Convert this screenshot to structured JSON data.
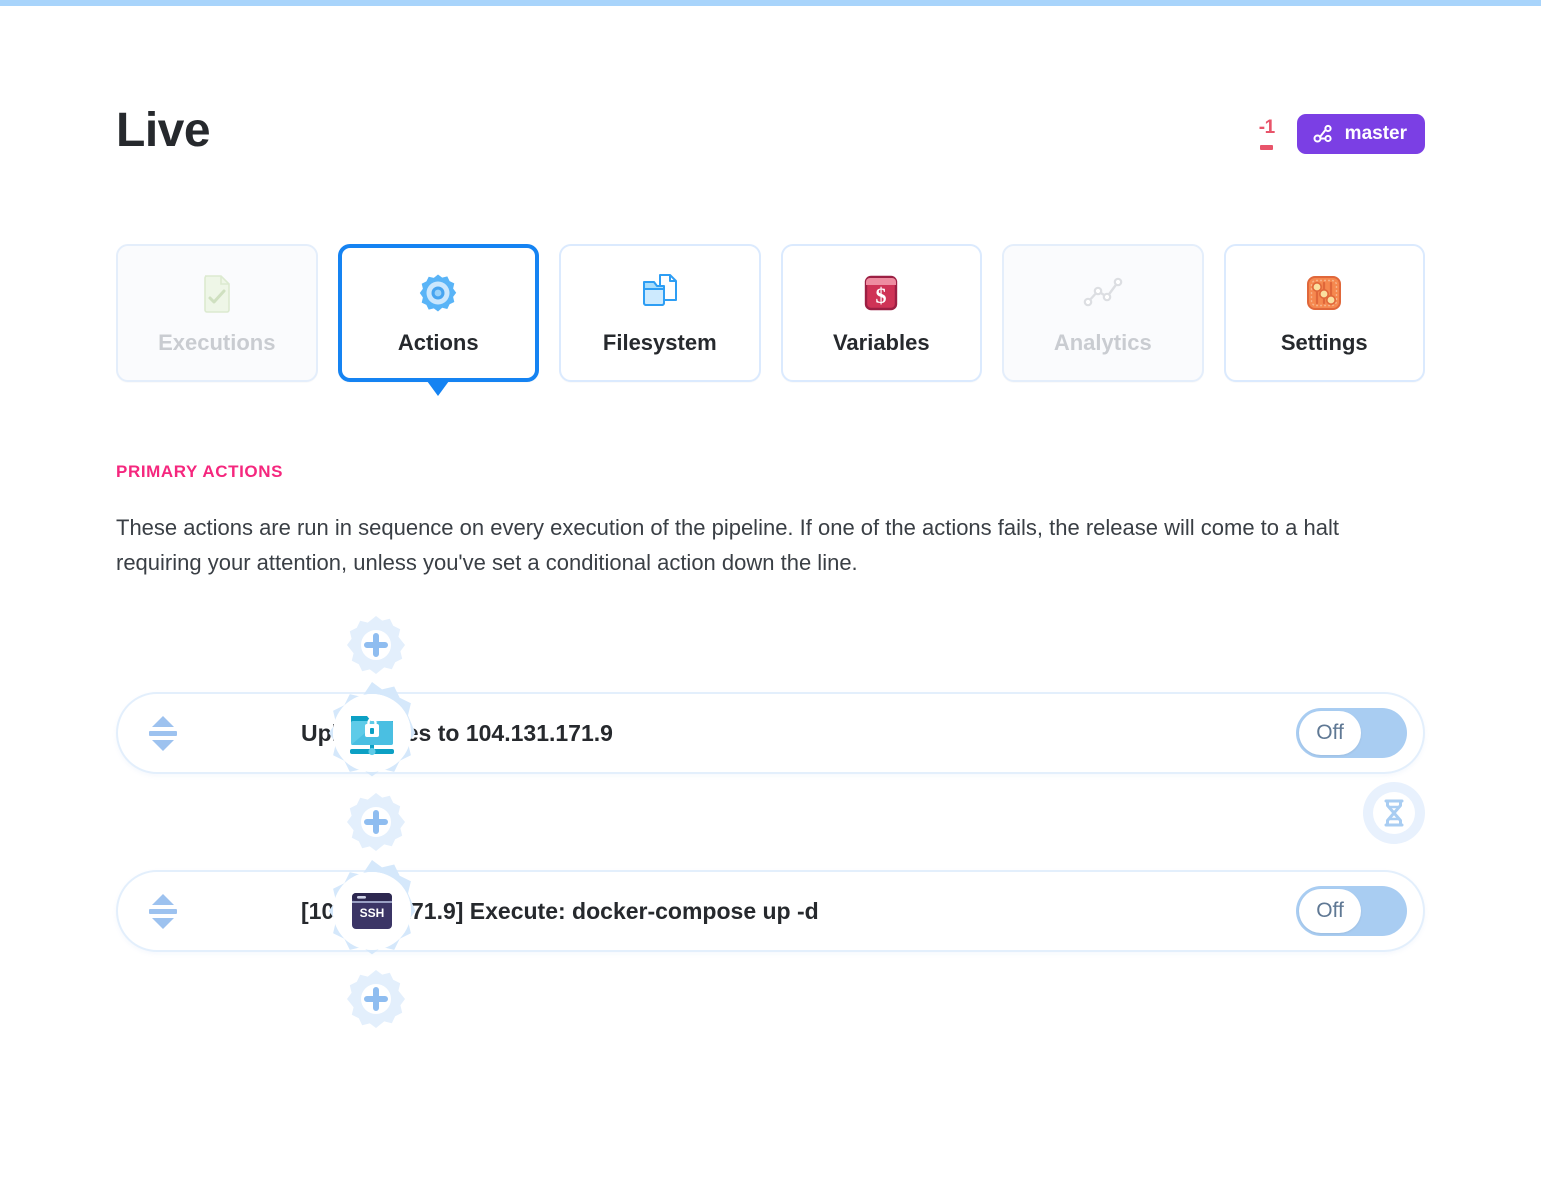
{
  "header": {
    "title": "Live",
    "diff_count": "-1",
    "branch_label": "master",
    "branch_icon": "branch-icon",
    "branch_color": "#7b3fe4",
    "diff_color": "#e8546a"
  },
  "tabs": [
    {
      "label": "Executions",
      "icon": "document-check-icon",
      "state": "disabled"
    },
    {
      "label": "Actions",
      "icon": "gear-icon",
      "state": "active"
    },
    {
      "label": "Filesystem",
      "icon": "folder-file-icon",
      "state": "default"
    },
    {
      "label": "Variables",
      "icon": "dollar-window-icon",
      "state": "default"
    },
    {
      "label": "Analytics",
      "icon": "line-chart-icon",
      "state": "disabled"
    },
    {
      "label": "Settings",
      "icon": "sliders-icon",
      "state": "default"
    }
  ],
  "section": {
    "title": "PRIMARY ACTIONS",
    "title_color": "#f5277e",
    "description": "These actions are run in sequence on every execution of the pipeline. If one of the actions fails, the release will come to a halt requiring your attention, unless you've set a conditional action down the line."
  },
  "actions": [
    {
      "label": "Upload files to 104.131.171.9",
      "icon": "sftp-folder-lock-icon",
      "toggle_label": "Off",
      "toggle_on": false
    },
    {
      "label": "[104.131.171.9] Execute: docker-compose up -d",
      "icon": "ssh-terminal-icon",
      "toggle_label": "Off",
      "toggle_on": false
    }
  ],
  "pipeline_controls": {
    "add_action_icon": "add-action-gear-icon",
    "wait_icon": "hourglass-icon"
  }
}
